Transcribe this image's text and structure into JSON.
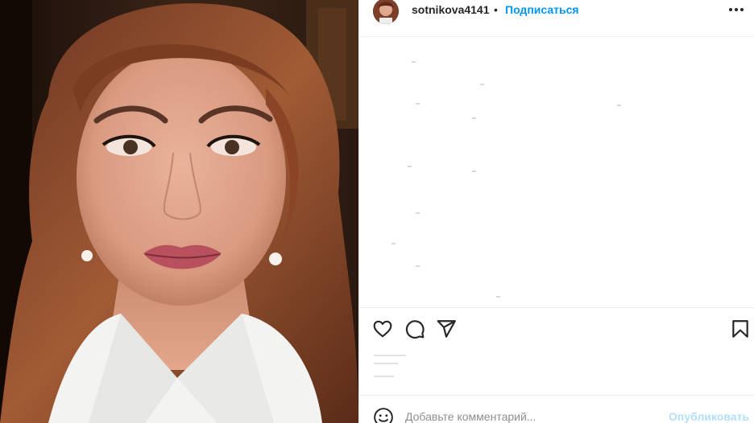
{
  "post": {
    "photo_icon": "portrait-photo"
  },
  "header": {
    "username": "sotnikova4141",
    "separator": "•",
    "follow_label": "Подписаться",
    "more_icon": "more-horizontal-icon"
  },
  "actions": {
    "like_icon": "heart-icon",
    "comment_icon": "comment-bubble-icon",
    "share_icon": "paper-plane-icon",
    "save_icon": "bookmark-icon"
  },
  "add_comment": {
    "emoji_icon": "smiley-icon",
    "placeholder": "Добавьте комментарий...",
    "publish_label": "Опубликовать"
  },
  "colors": {
    "accent": "#0095f6",
    "publish_disabled": "#b2dffc",
    "text": "#262626",
    "muted": "#8e8e8e",
    "border": "#efefef"
  }
}
